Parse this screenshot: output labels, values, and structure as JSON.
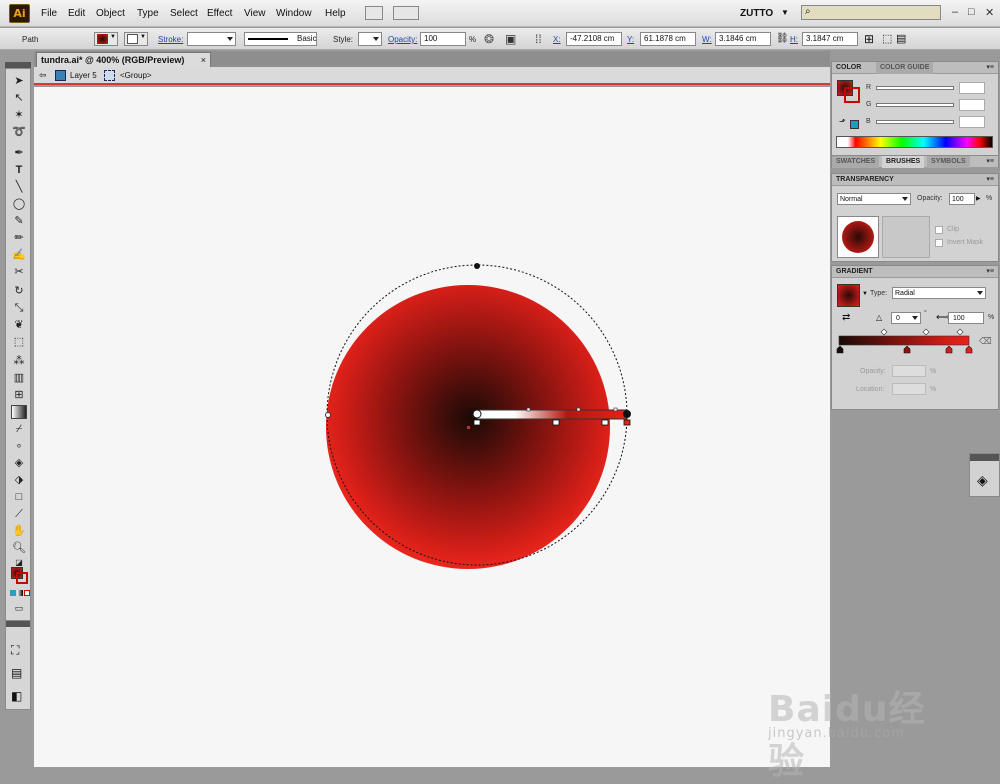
{
  "app": {
    "logo": "Ai",
    "workspace": "ZUTTO",
    "window_controls": [
      "–",
      "□",
      "✕"
    ]
  },
  "menu": [
    "File",
    "Edit",
    "Object",
    "Type",
    "Select",
    "Effect",
    "View",
    "Window",
    "Help"
  ],
  "control_bar": {
    "selection": "Path",
    "stroke_label": "Stroke:",
    "brush": "Basic",
    "style_label": "Style:",
    "opacity_label": "Opacity:",
    "opacity": "100",
    "pct": "%",
    "x_label": "X:",
    "x": "-47.2108 cm",
    "y_label": "Y:",
    "y": "61.1878 cm",
    "w_label": "W:",
    "w": "3.1846 cm",
    "h_label": "H:",
    "h": "3.1847 cm"
  },
  "document": {
    "tab": "tundra.ai* @ 400% (RGB/Preview)",
    "close": "×",
    "layer": "Layer 5",
    "group": "<Group>"
  },
  "color_panel": {
    "tabs": [
      "COLOR",
      "COLOR GUIDE"
    ],
    "channels": [
      "R",
      "G",
      "B"
    ],
    "swatch_tabs": [
      "SWATCHES",
      "BRUSHES",
      "SYMBOLS"
    ]
  },
  "transparency_panel": {
    "title": "TRANSPARENCY",
    "blend_mode": "Normal",
    "opacity_label": "Opacity:",
    "opacity": "100",
    "pct": "%",
    "clip": "Clip",
    "invert_mask": "Invert Mask"
  },
  "gradient_panel": {
    "title": "GRADIENT",
    "type_label": "Type:",
    "type": "Radial",
    "angle": "0",
    "degree": "°",
    "aspect": "100",
    "pct": "%",
    "opacity_label": "Opacity:",
    "location_label": "Location:",
    "stops": [
      {
        "location": 0,
        "color": "#1a0a06"
      },
      {
        "location": 51,
        "color": "#8a1410"
      },
      {
        "location": 84,
        "color": "#d41e18"
      },
      {
        "location": 100,
        "color": "#e8201a"
      }
    ]
  },
  "colors": {
    "accent_red": "#e8201a",
    "dark_center": "#1a0a06"
  },
  "watermark": {
    "brand": "Baidu经验",
    "url": "jingyan.baidu.com"
  }
}
